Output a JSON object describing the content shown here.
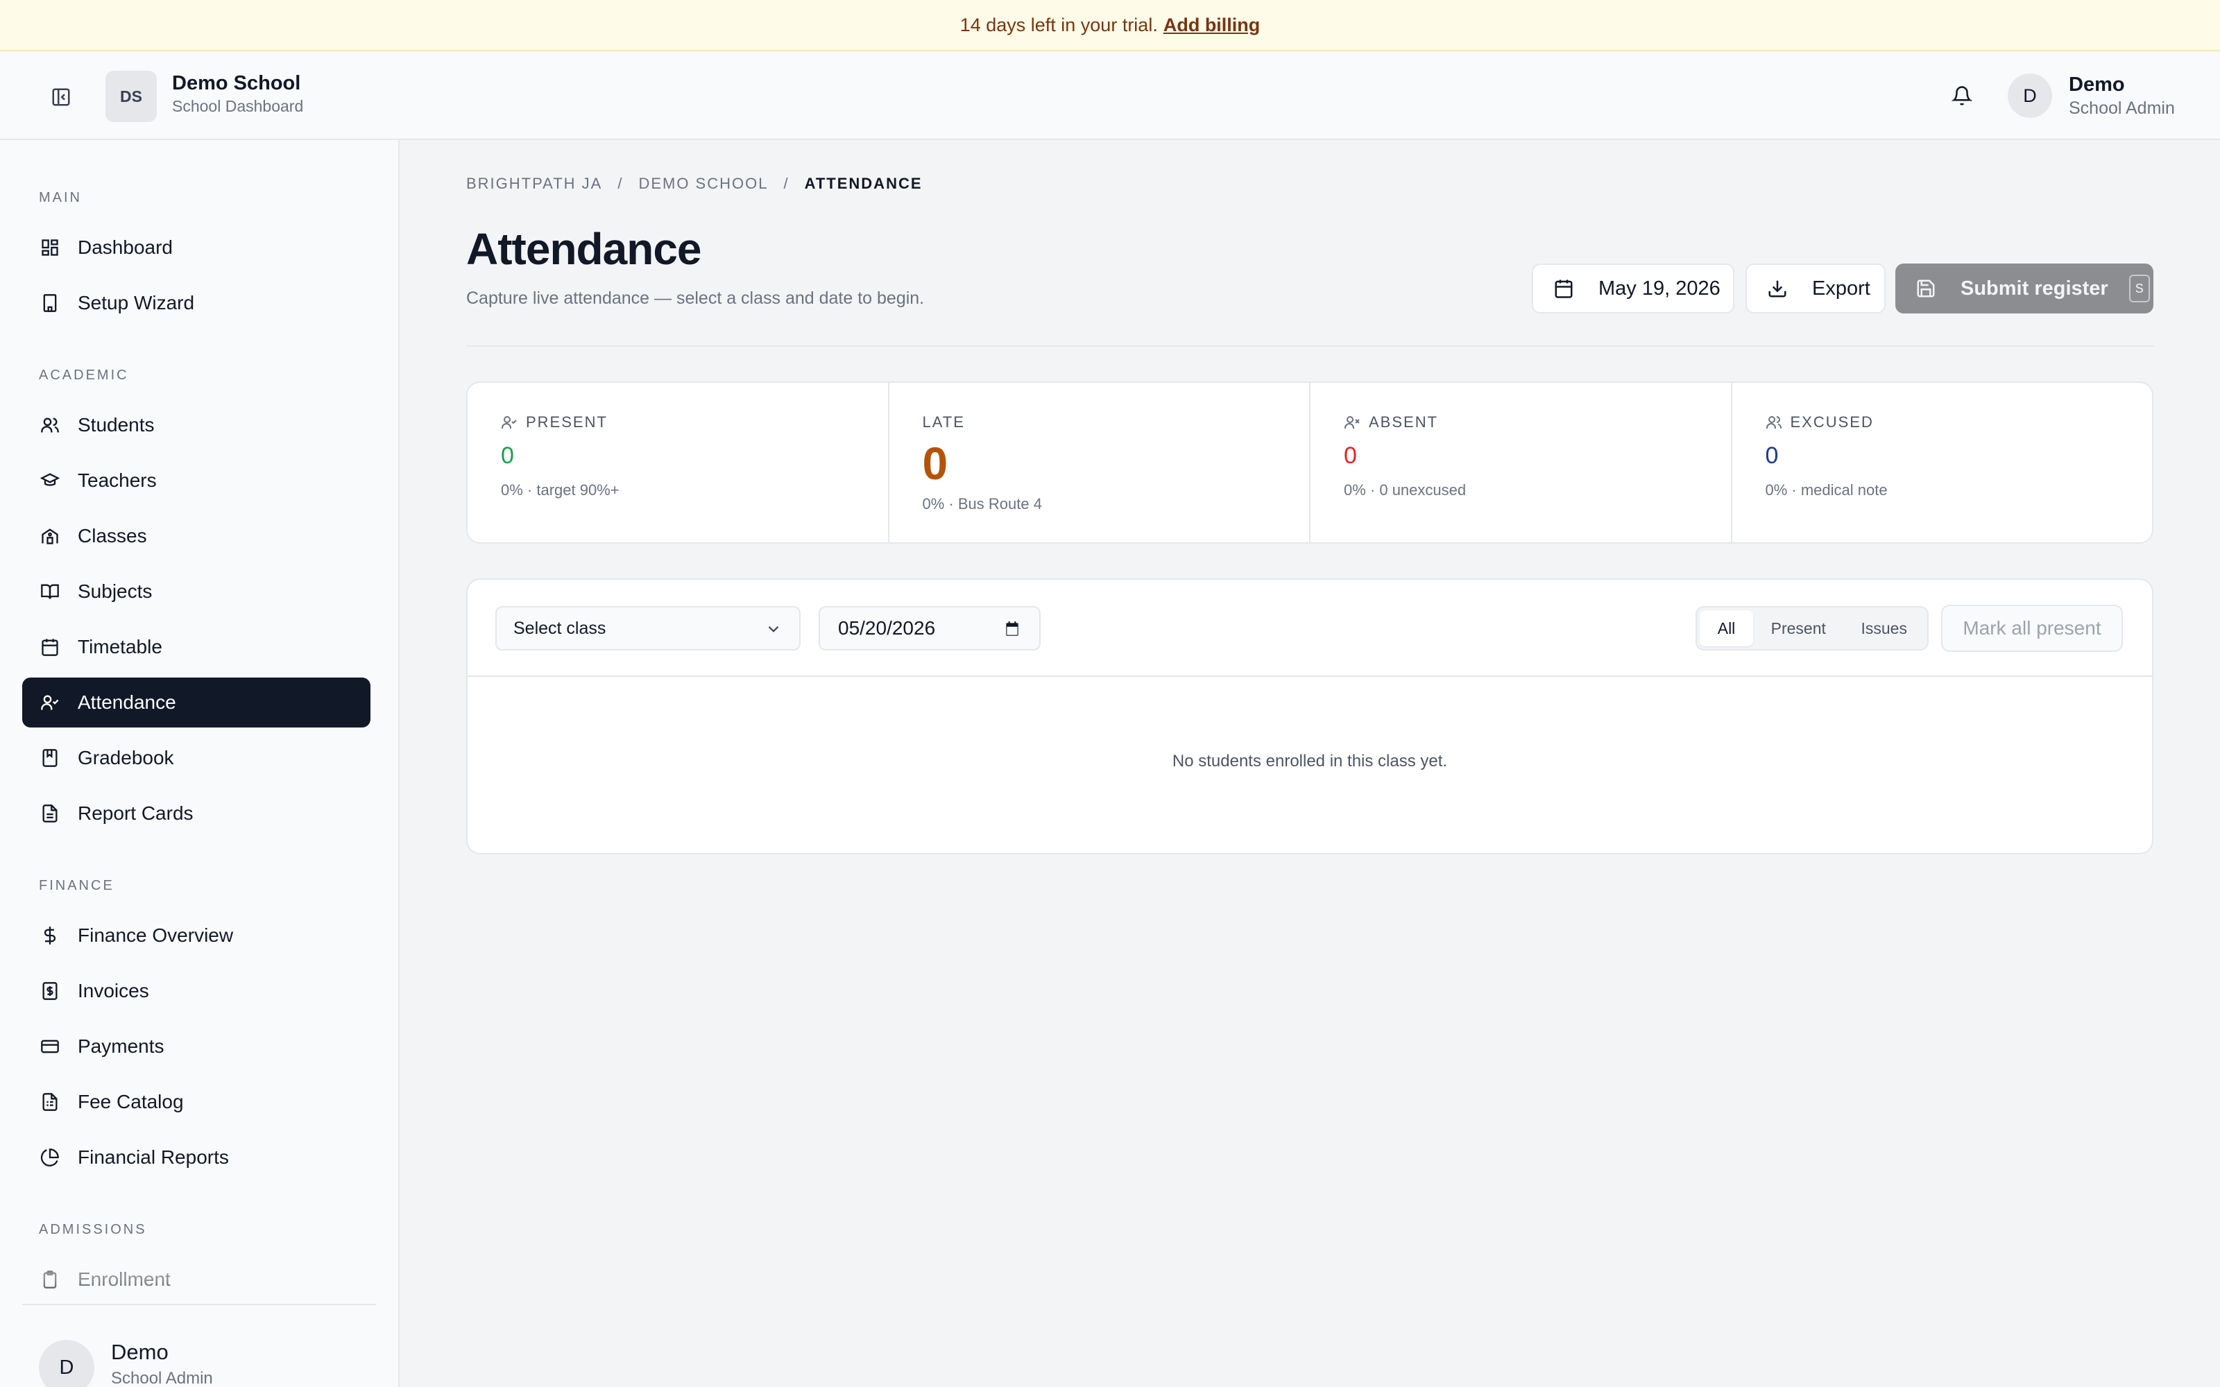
{
  "banner": {
    "text": "14 days left in your trial.",
    "link": "Add billing"
  },
  "header": {
    "school_initials": "DS",
    "school_name": "Demo School",
    "school_sub": "School Dashboard",
    "user_initial": "D",
    "user_name": "Demo",
    "user_role": "School Admin"
  },
  "sidebar": {
    "sections": {
      "main": "MAIN",
      "academic": "ACADEMIC",
      "finance": "FINANCE",
      "admissions": "ADMISSIONS"
    },
    "items": {
      "dashboard": "Dashboard",
      "setup_wizard": "Setup Wizard",
      "students": "Students",
      "teachers": "Teachers",
      "classes": "Classes",
      "subjects": "Subjects",
      "timetable": "Timetable",
      "attendance": "Attendance",
      "gradebook": "Gradebook",
      "report_cards": "Report Cards",
      "finance_overview": "Finance Overview",
      "invoices": "Invoices",
      "payments": "Payments",
      "fee_catalog": "Fee Catalog",
      "financial_reports": "Financial Reports",
      "enrollment": "Enrollment"
    },
    "active": "attendance",
    "user": {
      "initial": "D",
      "name": "Demo",
      "role": "School Admin"
    }
  },
  "breadcrumb": [
    "BRIGHTPATH JA",
    "DEMO SCHOOL",
    "ATTENDANCE"
  ],
  "page": {
    "title": "Attendance",
    "subtitle": "Capture live attendance — select a class and date to begin."
  },
  "actions": {
    "date": "May 19, 2026",
    "export": "Export",
    "submit": "Submit register",
    "submit_shortcut": "S"
  },
  "stats": [
    {
      "label": "PRESENT",
      "value": "0",
      "note": "0% · target 90%+",
      "color": "#16a34a"
    },
    {
      "label": "LATE",
      "value": "0",
      "note": "0% · Bus Route 4",
      "color": "#b45309"
    },
    {
      "label": "ABSENT",
      "value": "0",
      "note": "0% · 0 unexcused",
      "color": "#dc2626"
    },
    {
      "label": "EXCUSED",
      "value": "0",
      "note": "0% · medical note",
      "color": "#1e3a8a"
    }
  ],
  "filters": {
    "class_select": "Select class",
    "date_value": "05/20/2026",
    "segments": [
      "All",
      "Present",
      "Issues"
    ],
    "active_segment": "All",
    "mark_all": "Mark all present"
  },
  "empty_state": "No students enrolled in this class yet."
}
